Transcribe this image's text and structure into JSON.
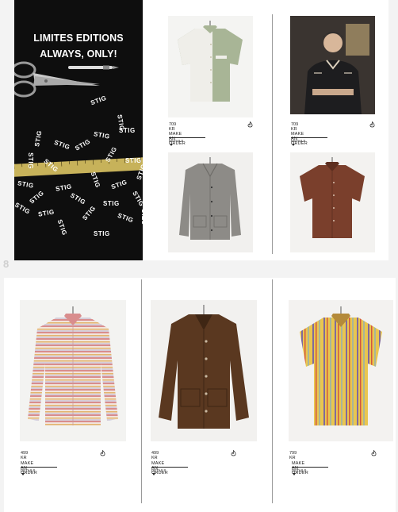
{
  "hero": {
    "line1": "LIMITES EDITIONS",
    "line2": "ALWAYS, ONLY!",
    "brand": "STIG"
  },
  "page_number": "8",
  "products": [
    {
      "id": "p1",
      "price": "709 KR",
      "order_label": "MAKE AN ORDER",
      "details_label": "DETAILS",
      "icon": "flame-icon",
      "colors": {
        "main": "#efeee9",
        "accent": "#a8b596"
      }
    },
    {
      "id": "p2",
      "price": "709 KR",
      "order_label": "MAKE AN ORDER",
      "details_label": "DETAILS",
      "icon": "flame-icon",
      "colors": {
        "main": "#1d1d1f",
        "accent": "#d8cdbb"
      }
    },
    {
      "id": "p3",
      "price": "",
      "order_label": "",
      "details_label": "",
      "icon": "",
      "colors": {
        "main": "#8d8b87",
        "accent": "#6e6c68"
      }
    },
    {
      "id": "p4",
      "price": "",
      "order_label": "",
      "details_label": "",
      "icon": "",
      "colors": {
        "main": "#7a3f2c",
        "accent": "#5e2f20"
      }
    },
    {
      "id": "p5",
      "price": "499 KR",
      "order_label": "MAKE AN ORDER",
      "details_label": "DETAILS",
      "icon": "flame-icon",
      "colors": {
        "main": "#f2e4dc",
        "accent": "#d98d8d"
      }
    },
    {
      "id": "p6",
      "price": "499 KR",
      "order_label": "MAKE AN ORDER",
      "details_label": "DETAILS",
      "icon": "flame-icon",
      "colors": {
        "main": "#5a3820",
        "accent": "#3f2614"
      }
    },
    {
      "id": "p7",
      "price": "799 KR",
      "order_label": "MAKE AN ORDER",
      "details_label": "DETAILS",
      "icon": "flame-icon",
      "colors": {
        "main": "#e9c64f",
        "accent": "#7f6a9e"
      }
    }
  ]
}
